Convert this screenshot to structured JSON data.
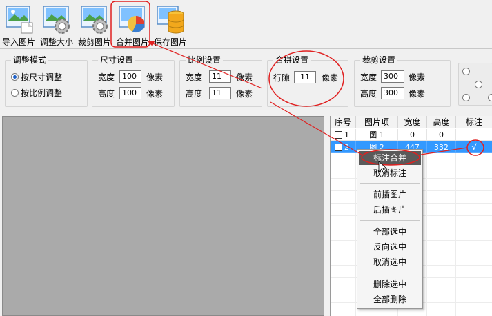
{
  "toolbar": {
    "buttons": [
      {
        "label": "导入图片",
        "icon": "import-image-icon"
      },
      {
        "label": "调整大小",
        "icon": "resize-gear-icon"
      },
      {
        "label": "裁剪图片",
        "icon": "crop-gear-icon"
      },
      {
        "label": "合并图片",
        "icon": "merge-pie-icon"
      },
      {
        "label": "保存图片",
        "icon": "save-database-icon"
      }
    ]
  },
  "settings": {
    "mode": {
      "title": "调整模式",
      "option1": "按尺寸调整",
      "option2": "按比例调整",
      "selected": "按尺寸调整"
    },
    "size": {
      "title": "尺寸设置",
      "width_label": "宽度",
      "width_value": "100",
      "width_unit": "像素",
      "height_label": "高度",
      "height_value": "100",
      "height_unit": "像素"
    },
    "ratio": {
      "title": "比例设置",
      "width_label": "宽度",
      "width_value": "11",
      "width_unit": "像素",
      "height_label": "高度",
      "height_value": "11",
      "height_unit": "像素"
    },
    "merge": {
      "title": "合拼设置",
      "gap_label": "行隙",
      "gap_value": "11",
      "gap_unit": "像素"
    },
    "crop": {
      "title": "裁剪设置",
      "width_label": "宽度",
      "width_value": "300",
      "width_unit": "像素",
      "height_label": "高度",
      "height_value": "300",
      "height_unit": "像素"
    }
  },
  "grid": {
    "headers": [
      "序号",
      "图片项",
      "宽度",
      "高度",
      "标注"
    ],
    "rows": [
      {
        "index": "1",
        "name": "图 1",
        "width": "0",
        "height": "0",
        "mark": ""
      },
      {
        "index": "2",
        "name": "图 2",
        "width": "447",
        "height": "332",
        "mark": "√"
      }
    ]
  },
  "context_menu": {
    "items": [
      "标注合并",
      "取消标注",
      "前插图片",
      "后插图片",
      "全部选中",
      "反向选中",
      "取消选中",
      "删除选中",
      "全部删除"
    ]
  },
  "colors": {
    "selection": "#3399ff",
    "annotation": "#e02020",
    "menu_highlight": "#5a5a5a"
  }
}
